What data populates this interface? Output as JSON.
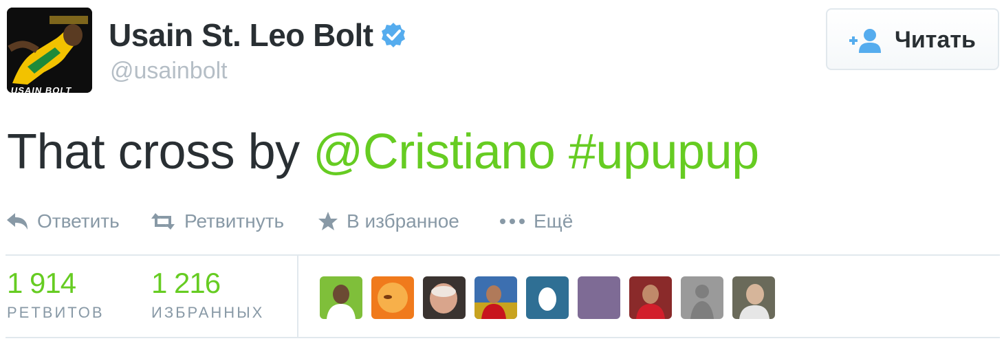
{
  "author": {
    "display_name": "Usain St. Leo Bolt",
    "screen_name": "@usainbolt",
    "avatar_caption": "USAIN BOLT",
    "verified": true,
    "verified_color": "#55acee"
  },
  "follow_button": {
    "label": "Читать",
    "icon": "add-user-icon"
  },
  "tweet": {
    "text_plain": "That cross by ",
    "mention": "@Cristiano",
    "hashtag": "#upupup",
    "link_color": "#66cc22"
  },
  "actions": [
    {
      "icon": "reply-icon",
      "label": "Ответить"
    },
    {
      "icon": "retweet-icon",
      "label": "Ретвитнуть"
    },
    {
      "icon": "star-icon",
      "label": "В избранное"
    },
    {
      "icon": "more-dots-icon",
      "label": "Ещё"
    }
  ],
  "stats": {
    "retweets": {
      "count": "1 914",
      "label": "РЕТВИТОВ"
    },
    "favorites": {
      "count": "1 216",
      "label": "ИЗБРАННЫХ"
    }
  },
  "favoriters_count_shown": 9
}
